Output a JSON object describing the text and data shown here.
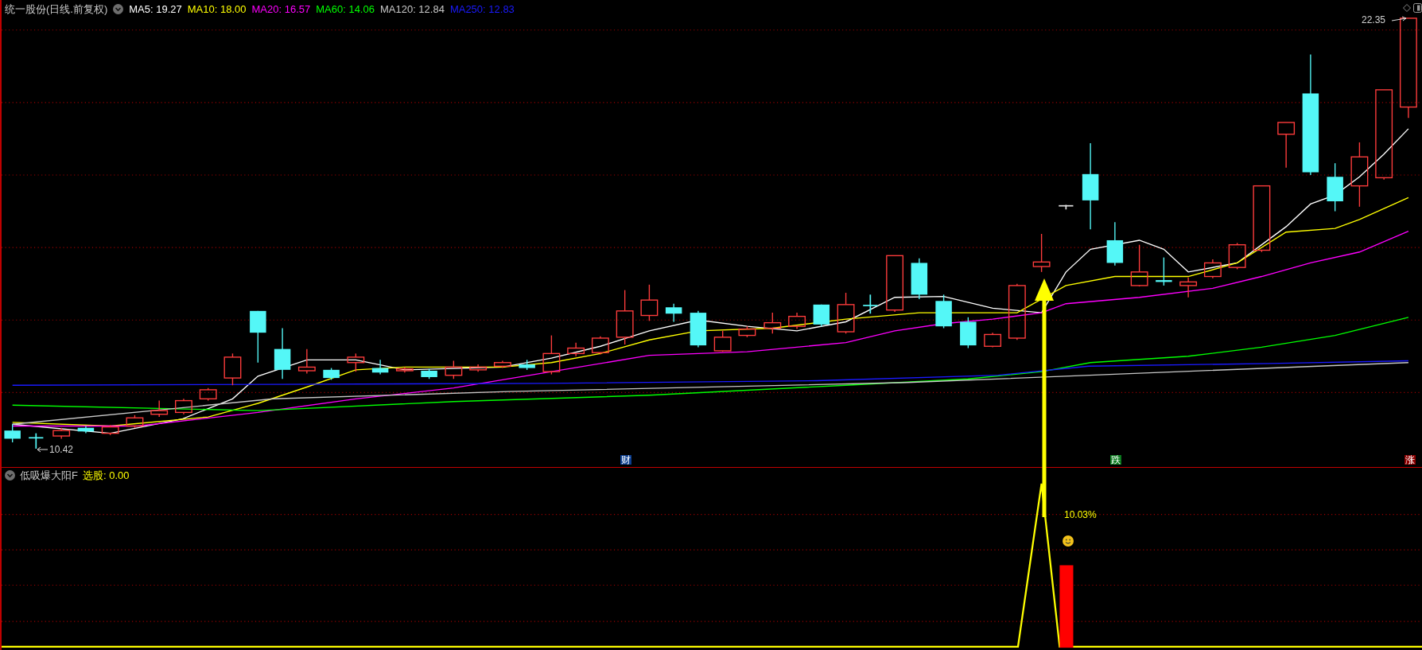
{
  "chart": {
    "title": "统一股份(日线.前复权)",
    "ma_legend": [
      {
        "label": "MA5: 19.27",
        "color": "#ffffff"
      },
      {
        "label": "MA10: 18.00",
        "color": "#ffff00"
      },
      {
        "label": "MA20: 16.57",
        "color": "#ff00ff"
      },
      {
        "label": "MA60: 14.06",
        "color": "#00ff00"
      },
      {
        "label": "MA120: 12.84",
        "color": "#c8c8c8"
      },
      {
        "label": "MA250: 12.83",
        "color": "#1a1aff"
      }
    ],
    "high_label": "22.35",
    "low_label": "10.42",
    "event_markers": [
      {
        "label": "财",
        "color": "#0a3d8f"
      },
      {
        "label": "跌",
        "color": "#0a7a1e"
      },
      {
        "label": "涨",
        "color": "#8b0000"
      }
    ]
  },
  "indicator": {
    "title": "低吸爆大阳F",
    "reading": "选股: 0.00",
    "signal_label": "10.03%"
  }
}
